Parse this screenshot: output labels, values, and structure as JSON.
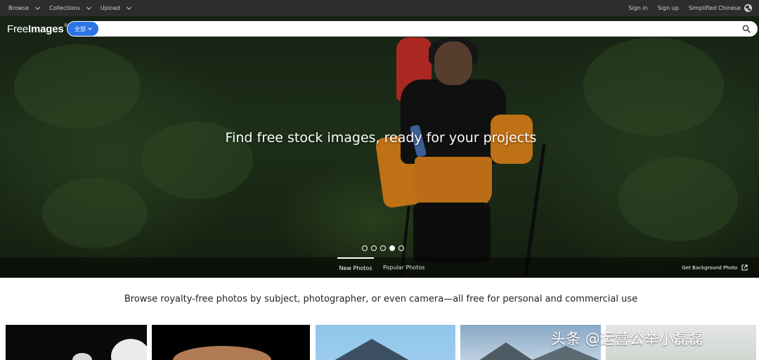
{
  "topbar": {
    "nav": [
      {
        "label": "Browse",
        "icon": "chevron-down-icon"
      },
      {
        "label": "Collections",
        "icon": "chevron-down-icon"
      },
      {
        "label": "Upload",
        "icon": "chevron-down-icon"
      }
    ],
    "sign_in": "Sign in",
    "sign_up": "Sign up",
    "language": "Simplified Chinese",
    "language_icon": "globe-icon"
  },
  "header": {
    "logo_free": "Free",
    "logo_images": "Images",
    "logo_mark": "®",
    "search": {
      "category": "全部",
      "value": "",
      "placeholder": "",
      "icon": "search-icon"
    }
  },
  "hero": {
    "headline": "Find free stock images, ready for your projects",
    "carousel": {
      "count": 5,
      "active_index": 3
    },
    "tabs": [
      "New Photos",
      "Popular Photos"
    ],
    "active_tab": "New Photos",
    "get_background": "Get Background Photo",
    "external_icon": "external-link-icon"
  },
  "main": {
    "browse_text": "Browse royalty-free photos by subject, photographer, or even camera—all free for personal and commercial use"
  },
  "watermark": "头条 @运营公举小磊磊",
  "colors": {
    "topbar_bg": "#2d2d2d",
    "accent": "#2b73e6"
  }
}
